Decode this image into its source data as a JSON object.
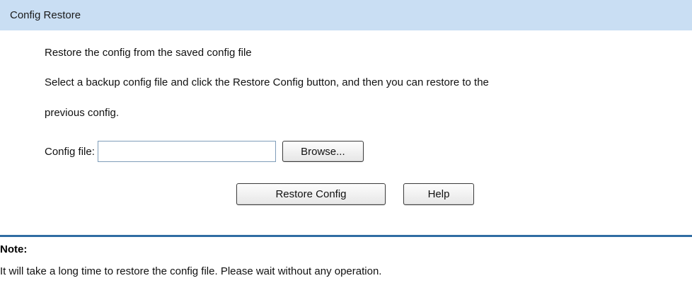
{
  "panel": {
    "title": "Config Restore"
  },
  "description": {
    "line1": "Restore the config from the saved config file",
    "line2": "Select a backup config file and click the Restore Config button, and then you can restore to the",
    "line3": "previous config."
  },
  "file_field": {
    "label": "Config file:",
    "value": "",
    "placeholder": "",
    "browse_label": "Browse..."
  },
  "actions": {
    "restore_label": "Restore Config",
    "help_label": "Help"
  },
  "note": {
    "title": "Note:",
    "text": "It will take a long time to restore the config file. Please wait without any operation."
  },
  "colors": {
    "header_bg": "#c9def3",
    "divider": "#2f6ca3"
  }
}
